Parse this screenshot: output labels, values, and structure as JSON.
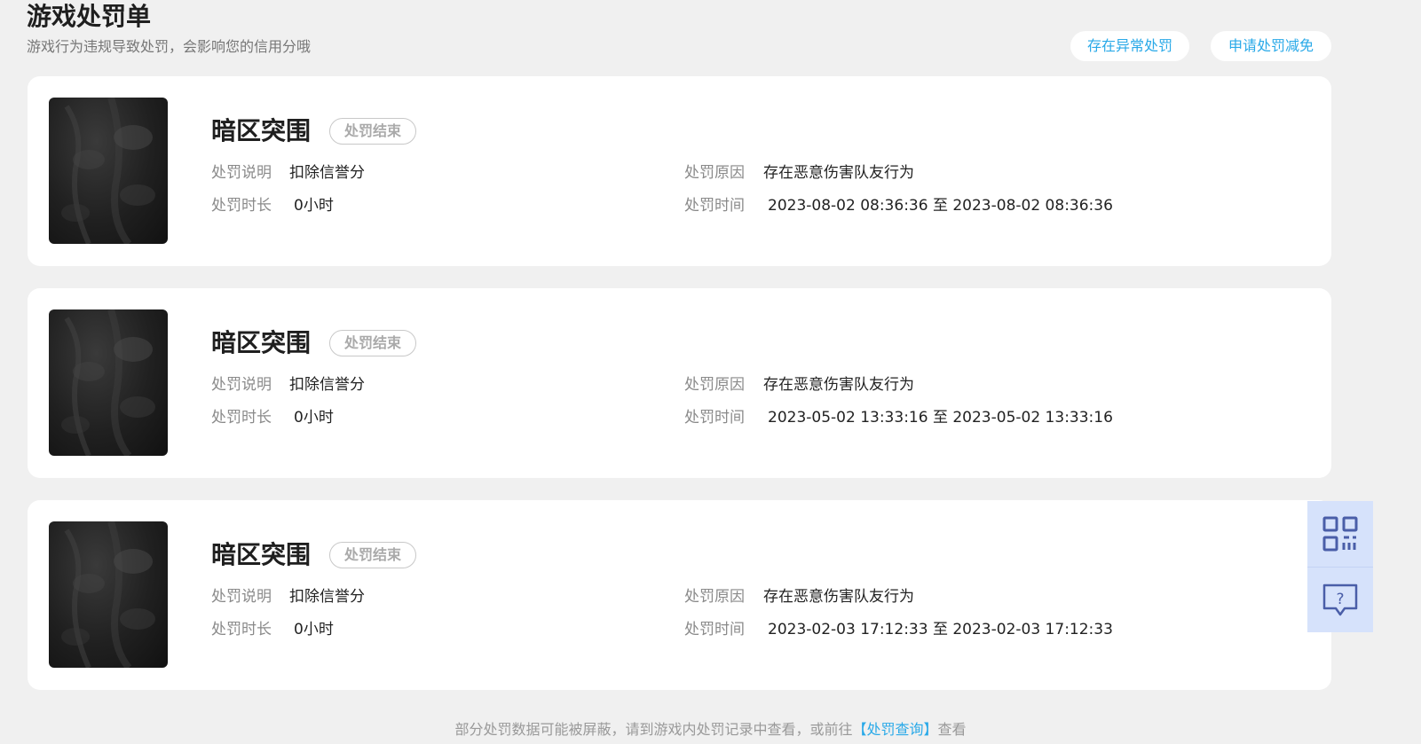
{
  "header": {
    "title": "游戏处罚单",
    "subtitle": "游戏行为违规导致处罚，会影响您的信用分哦",
    "abnormal_button": "存在异常处罚",
    "reduce_button": "申请处罚减免"
  },
  "labels": {
    "desc": "处罚说明",
    "duration": "处罚时长",
    "reason": "处罚原因",
    "time": "处罚时间"
  },
  "records": [
    {
      "game": "暗区突围",
      "status": "处罚结束",
      "desc": "扣除信誉分",
      "duration": "0小时",
      "reason": "存在恶意伤害队友行为",
      "time": "2023-08-02 08:36:36 至 2023-08-02 08:36:36"
    },
    {
      "game": "暗区突围",
      "status": "处罚结束",
      "desc": "扣除信誉分",
      "duration": "0小时",
      "reason": "存在恶意伤害队友行为",
      "time": "2023-05-02 13:33:16 至 2023-05-02 13:33:16"
    },
    {
      "game": "暗区突围",
      "status": "处罚结束",
      "desc": "扣除信誉分",
      "duration": "0小时",
      "reason": "存在恶意伤害队友行为",
      "time": "2023-02-03 17:12:33 至 2023-02-03 17:12:33"
    }
  ],
  "side_panel": {
    "qr_icon": "qr-code-icon",
    "help_icon": "help-chat-icon",
    "icon_color": "#4a5ea8"
  },
  "footer": {
    "text_before": "部分处罚数据可能被屏蔽，请到游戏内处罚记录中查看，或前往",
    "link": "【处罚查询】",
    "text_after": "查看"
  },
  "colors": {
    "accent": "#29a9e8",
    "background": "#f0f0f0",
    "card": "#ffffff"
  }
}
